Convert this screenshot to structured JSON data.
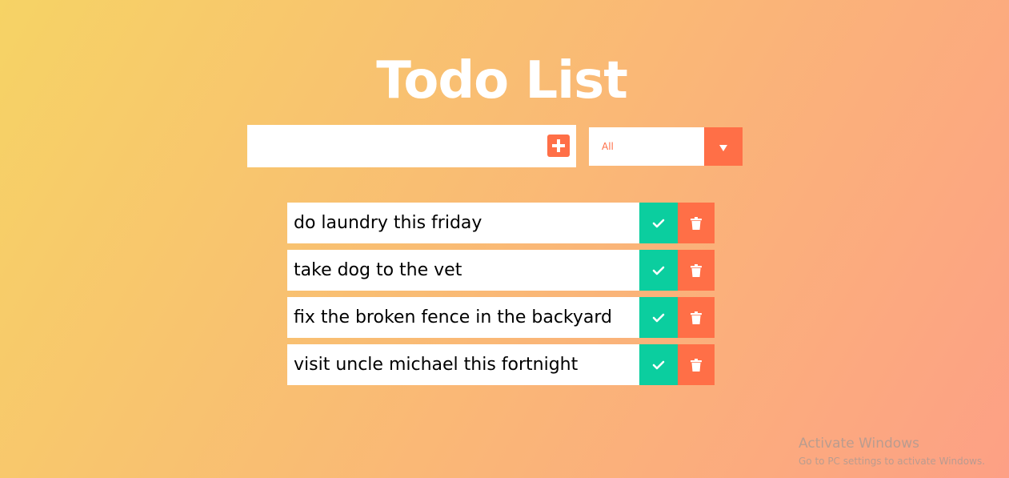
{
  "app": {
    "title": "Todo List"
  },
  "input": {
    "value": "",
    "placeholder": "",
    "add_icon": "plus-square-icon"
  },
  "filter": {
    "selected": "All",
    "arrow_icon": "caret-down-icon"
  },
  "todos": [
    {
      "text": "do laundry this friday",
      "complete_icon": "check-icon",
      "delete_icon": "trash-icon"
    },
    {
      "text": "take dog to the vet",
      "complete_icon": "check-icon",
      "delete_icon": "trash-icon"
    },
    {
      "text": "fix the broken fence in the backyard",
      "complete_icon": "check-icon",
      "delete_icon": "trash-icon"
    },
    {
      "text": "visit uncle michael this fortnight",
      "complete_icon": "check-icon",
      "delete_icon": "trash-icon"
    }
  ],
  "watermark": {
    "title": "Activate Windows",
    "subtitle": "Go to PC settings to activate Windows."
  },
  "colors": {
    "gradient_start": "#f6d365",
    "gradient_end": "#fda085",
    "accent": "#ff6f47",
    "complete": "#0bce9f",
    "surface": "#ffffff"
  }
}
